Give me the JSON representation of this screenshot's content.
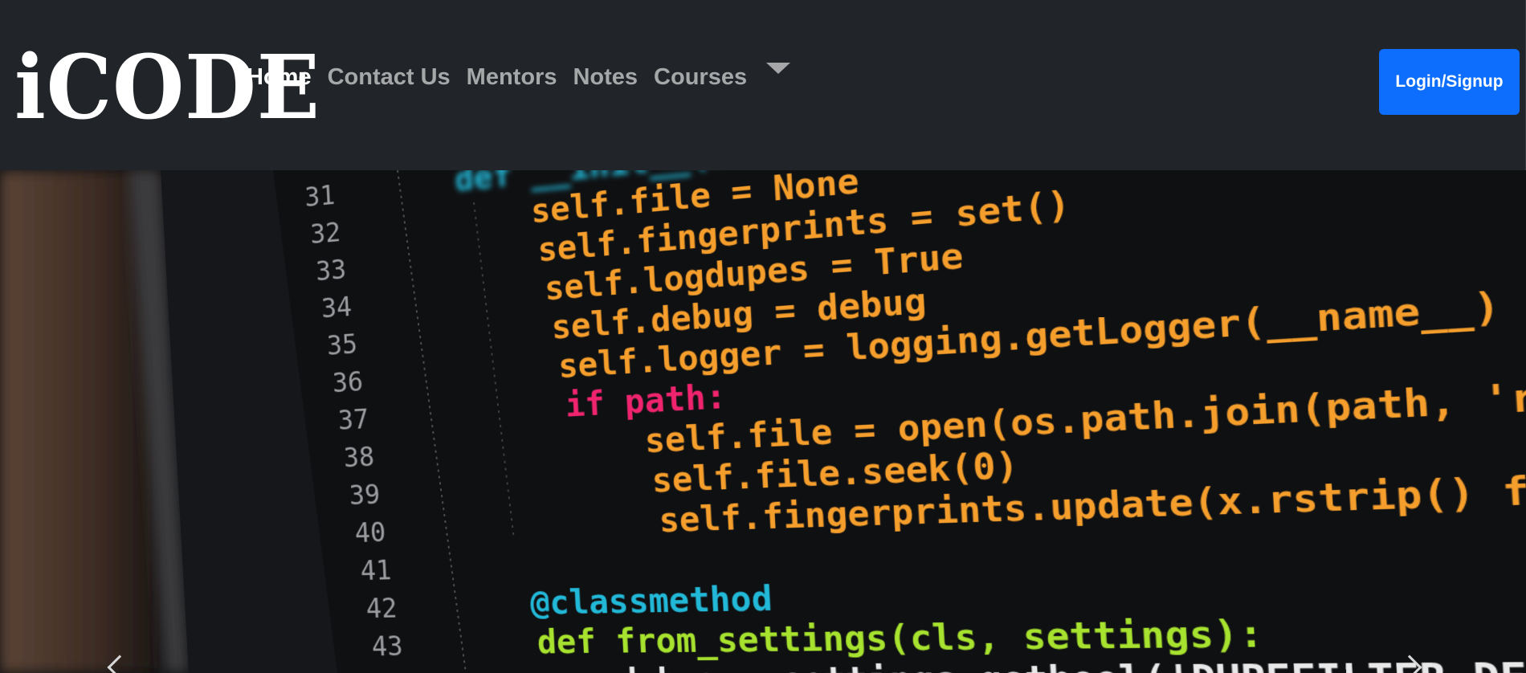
{
  "brand": {
    "name": "iCODE"
  },
  "nav": {
    "items": [
      {
        "label": "Home",
        "active": true
      },
      {
        "label": "Contact Us",
        "active": false
      },
      {
        "label": "Mentors",
        "active": false
      },
      {
        "label": "Notes",
        "active": false
      },
      {
        "label": "Courses",
        "active": false
      }
    ],
    "dropdown_icon": "chevron-down-icon",
    "login_label": "Login/Signup"
  },
  "hero": {
    "line_numbers": [
      "31",
      "32",
      "33",
      "34",
      "35",
      "36",
      "37",
      "38",
      "39",
      "40",
      "41",
      "42",
      "43"
    ],
    "code_lines": [
      "def __init__(self, path",
      "self.file = None",
      "self.fingerprints = set()",
      "self.logdupes = True",
      "self.debug = debug",
      "self.logger = logging.getLogger(__name__)",
      "if path:",
      "self.file = open(os.path.join(path, 'requests.seen'),",
      "self.file.seek(0)",
      "self.fingerprints.update(x.rstrip() for x in self.file)",
      "@classmethod",
      "def from_settings(cls, settings):",
      "debug = settings.getbool('DUPEFILTER_DEBUG')"
    ],
    "prev_icon": "chevron-left-icon",
    "next_icon": "chevron-right-icon"
  },
  "colors": {
    "navbar_bg": "#212529",
    "login_button": "#0d6efd",
    "nav_active": "#ffffff",
    "nav_inactive": "#a6a7a8"
  }
}
